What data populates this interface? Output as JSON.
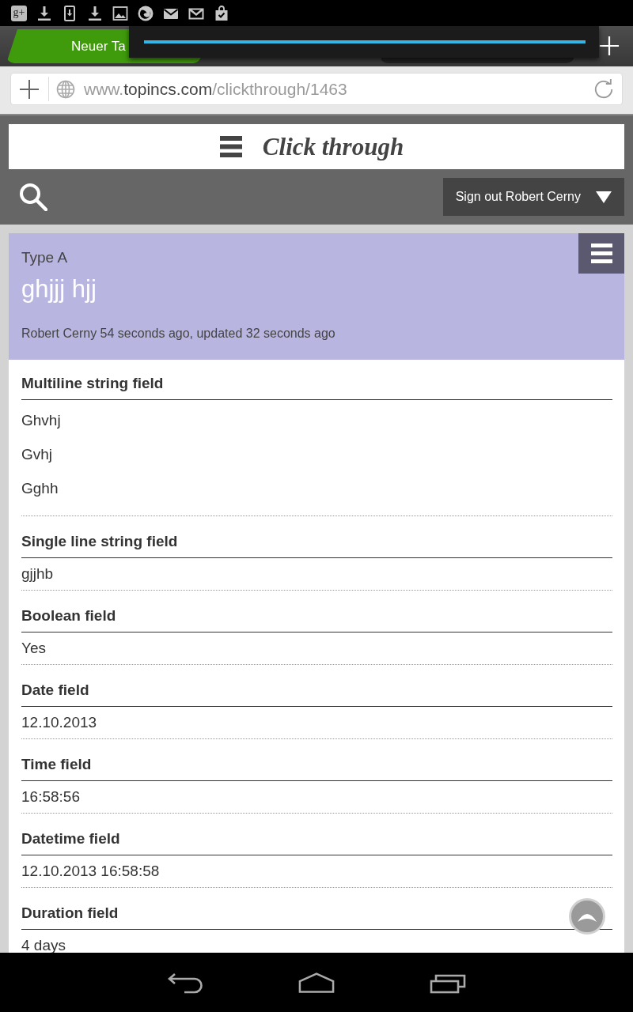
{
  "status_bar": {
    "app_badge": "g+"
  },
  "tabs": [
    {
      "label": "Neuer Ta",
      "selected": true
    },
    {
      "selected": false
    }
  ],
  "loading_popup": {
    "level": 1
  },
  "address_bar": {
    "url": {
      "prefix": "www.",
      "domain": "topincs.com",
      "path": "/clickthrough/1463"
    }
  },
  "site_header": {
    "title": "Click through",
    "sign_out": "Sign out Robert Cerny"
  },
  "record": {
    "type": "Type A",
    "title": "ghjjj hjj",
    "meta": "Robert Cerny 54 seconds ago, updated 32 seconds ago",
    "fields": [
      {
        "label": "Multiline string field",
        "kind": "multiline",
        "values": [
          "Ghvhj",
          "Gvhj",
          "Gghh"
        ]
      },
      {
        "label": "Single line string field",
        "kind": "text",
        "values": [
          "gjjhb"
        ]
      },
      {
        "label": "Boolean field",
        "kind": "text",
        "values": [
          "Yes"
        ]
      },
      {
        "label": "Date field",
        "kind": "text",
        "values": [
          "12.10.2013"
        ]
      },
      {
        "label": "Time field",
        "kind": "text",
        "values": [
          "16:58:56"
        ]
      },
      {
        "label": "Datetime field",
        "kind": "text",
        "values": [
          "12.10.2013 16:58:58"
        ]
      },
      {
        "label": "Duration field",
        "kind": "text",
        "values": [
          "4 days"
        ]
      }
    ]
  }
}
